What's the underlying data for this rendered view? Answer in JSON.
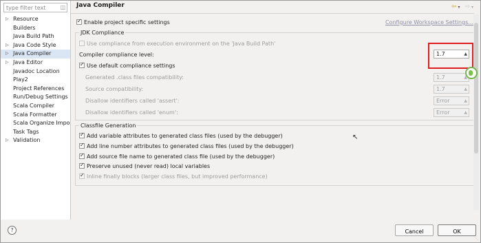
{
  "filter": {
    "placeholder": "type filter text",
    "clear_icon": "clear-icon"
  },
  "tree": [
    {
      "label": "Resource",
      "expandable": true,
      "selected": false
    },
    {
      "label": "Builders",
      "expandable": false,
      "selected": false
    },
    {
      "label": "Java Build Path",
      "expandable": false,
      "selected": false
    },
    {
      "label": "Java Code Style",
      "expandable": true,
      "selected": false
    },
    {
      "label": "Java Compiler",
      "expandable": true,
      "selected": true
    },
    {
      "label": "Java Editor",
      "expandable": true,
      "selected": false
    },
    {
      "label": "Javadoc Location",
      "expandable": false,
      "selected": false
    },
    {
      "label": "Play2",
      "expandable": false,
      "selected": false
    },
    {
      "label": "Project References",
      "expandable": false,
      "selected": false
    },
    {
      "label": "Run/Debug Settings",
      "expandable": false,
      "selected": false
    },
    {
      "label": "Scala Compiler",
      "expandable": false,
      "selected": false
    },
    {
      "label": "Scala Formatter",
      "expandable": false,
      "selected": false
    },
    {
      "label": "Scala Organize Import",
      "expandable": false,
      "selected": false
    },
    {
      "label": "Task Tags",
      "expandable": false,
      "selected": false
    },
    {
      "label": "Validation",
      "expandable": true,
      "selected": false
    }
  ],
  "page": {
    "title": "Java Compiler",
    "enable_specific": "Enable project specific settings",
    "configure_link": "Configure Workspace Settings...",
    "jdk": {
      "legend": "JDK Compliance",
      "use_env": "Use compliance from execution environment on the 'Java Build Path'",
      "compliance_label": "Compiler compliance level:",
      "compliance_value": "1.7",
      "use_default": "Use default compliance settings",
      "generated_label": "Generated .class files compatibility:",
      "generated_value": "1.7",
      "source_label": "Source compatibility:",
      "source_value": "1.7",
      "assert_label": "Disallow identifiers called 'assert':",
      "assert_value": "Error",
      "enum_label": "Disallow identifiers called 'enum':",
      "enum_value": "Error"
    },
    "classfile": {
      "legend": "Classfile Generation",
      "opt1": "Add variable attributes to generated class files (used by the debugger)",
      "opt2": "Add line number attributes to generated class files (used by the debugger)",
      "opt3": "Add source file name to generated class file (used by the debugger)",
      "opt4": "Preserve unused (never read) local variables",
      "opt5": "Inline finally blocks (larger class files, but improved performance)"
    }
  },
  "buttons": {
    "help": "?",
    "cancel": "Cancel",
    "ok": "OK"
  },
  "colors": {
    "highlight": "#e01b1b",
    "selection": "#dbe6f4"
  }
}
